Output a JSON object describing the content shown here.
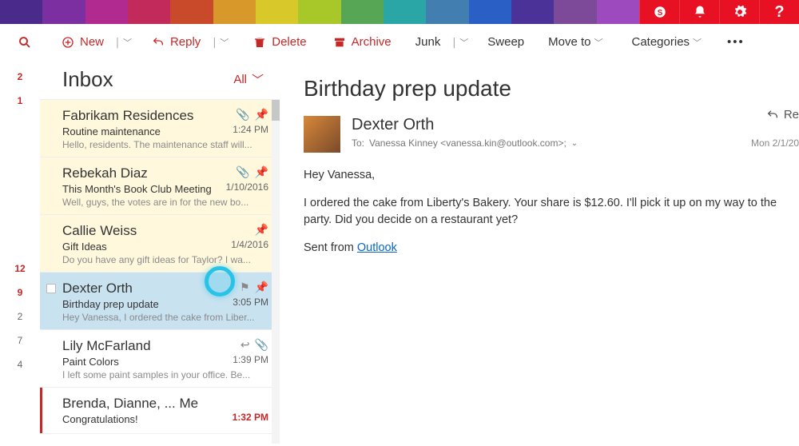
{
  "topIcons": [
    "skype",
    "bell",
    "gear",
    "help"
  ],
  "toolbar": {
    "new": "New",
    "reply": "Reply",
    "delete": "Delete",
    "archive": "Archive",
    "junk": "Junk",
    "sweep": "Sweep",
    "moveto": "Move to",
    "categories": "Categories"
  },
  "rail": {
    "items": [
      {
        "value": "2",
        "red": true
      },
      {
        "value": "1",
        "red": true
      },
      {
        "value": "",
        "red": false
      },
      {
        "value": "",
        "red": false
      },
      {
        "value": "",
        "red": false
      },
      {
        "value": "",
        "red": false
      },
      {
        "value": "",
        "red": false
      },
      {
        "value": "",
        "red": false
      },
      {
        "value": "12",
        "red": true
      },
      {
        "value": "9",
        "red": true
      },
      {
        "value": "2",
        "red": false
      },
      {
        "value": "7",
        "red": false
      },
      {
        "value": "4",
        "red": false
      }
    ]
  },
  "list": {
    "title": "Inbox",
    "filter": "All"
  },
  "messages": [
    {
      "sender": "Fabrikam Residences",
      "subject": "Routine maintenance",
      "preview": "Hello, residents. The maintenance staff will...",
      "date": "1:24 PM",
      "clip": true,
      "pin": true,
      "bg": "yellow"
    },
    {
      "sender": "Rebekah Diaz",
      "subject": "This Month's Book Club Meeting",
      "preview": "Well, guys, the votes are in for the new bo...",
      "date": "1/10/2016",
      "clip": true,
      "pin": true,
      "bg": "yellow"
    },
    {
      "sender": "Callie Weiss",
      "subject": "Gift Ideas",
      "preview": "Do you have any gift ideas for Taylor? I wa...",
      "date": "1/4/2016",
      "clip": false,
      "pin": true,
      "bg": "yellow"
    },
    {
      "sender": "Dexter Orth",
      "subject": "Birthday prep update",
      "preview": "Hey Vanessa, I ordered the cake from Liber...",
      "date": "3:05 PM",
      "clip": false,
      "pin": false,
      "bg": "blue",
      "selected": true,
      "chk": true,
      "pinGray": true
    },
    {
      "sender": "Lily McFarland",
      "subject": "Paint Colors",
      "preview": "I left some paint samples in your office. Be...",
      "date": "1:39 PM",
      "clip": true,
      "pin": false,
      "replyicon": true
    },
    {
      "sender": "Brenda, Dianne, ... Me",
      "subject": "Congratulations!",
      "preview": "",
      "date": "1:32 PM",
      "clip": false,
      "pin": false,
      "redtime": true,
      "leftbar": true
    }
  ],
  "reading": {
    "subject": "Birthday prep update",
    "from": "Dexter Orth",
    "toLabel": "To:",
    "toValue": "Vanessa Kinney <vanessa.kin@outlook.com>;",
    "reply": "Re",
    "timestamp": "Mon 2/1/20",
    "body": {
      "greeting": "Hey Vanessa,",
      "para1": "I ordered the cake from Liberty's Bakery. Your share is $12.60. I'll pick it up on my way to the party. Did you decide on a restaurant yet?",
      "sentFrom": "Sent from ",
      "sentLink": "Outlook"
    }
  }
}
